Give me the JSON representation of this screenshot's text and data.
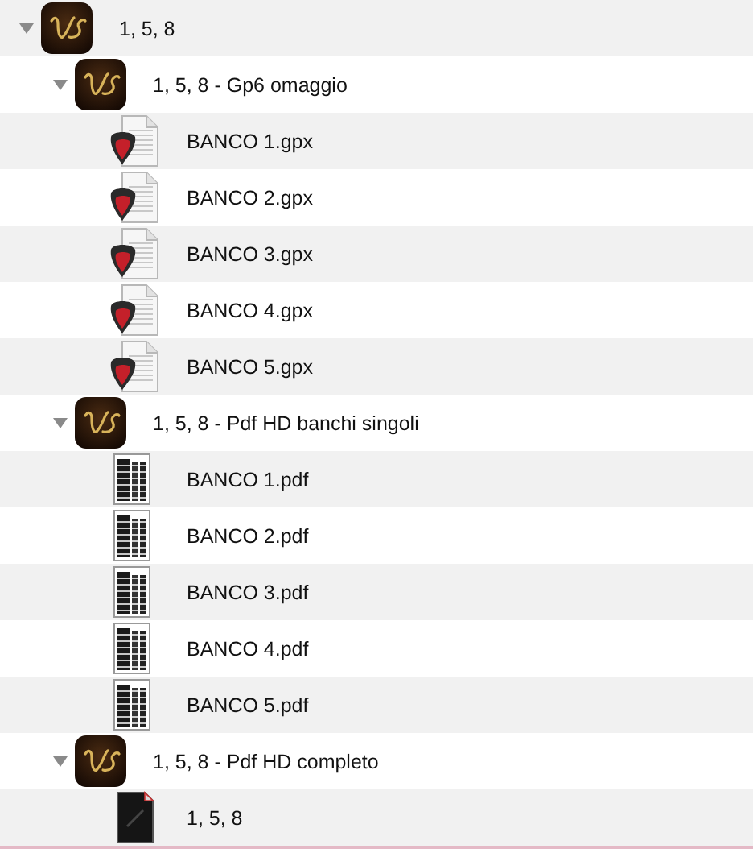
{
  "items": [
    {
      "kind": "folder",
      "label": "1, 5, 8",
      "expanded": true,
      "children": [
        {
          "kind": "folder",
          "label": "1, 5, 8 - Gp6 omaggio",
          "expanded": true,
          "children": [
            {
              "kind": "gpx",
              "label": "BANCO 1.gpx"
            },
            {
              "kind": "gpx",
              "label": "BANCO 2.gpx"
            },
            {
              "kind": "gpx",
              "label": "BANCO 3.gpx"
            },
            {
              "kind": "gpx",
              "label": "BANCO 4.gpx"
            },
            {
              "kind": "gpx",
              "label": "BANCO 5.gpx"
            }
          ]
        },
        {
          "kind": "folder",
          "label": "1, 5, 8 - Pdf HD banchi singoli",
          "expanded": true,
          "children": [
            {
              "kind": "pdf",
              "label": "BANCO 1.pdf"
            },
            {
              "kind": "pdf",
              "label": "BANCO 2.pdf"
            },
            {
              "kind": "pdf",
              "label": "BANCO 3.pdf"
            },
            {
              "kind": "pdf",
              "label": "BANCO 4.pdf"
            },
            {
              "kind": "pdf",
              "label": "BANCO 5.pdf"
            }
          ]
        },
        {
          "kind": "folder",
          "label": "1, 5, 8 - Pdf HD completo",
          "expanded": true,
          "children": [
            {
              "kind": "pdf-dark",
              "label": "1, 5, 8"
            }
          ]
        }
      ]
    }
  ]
}
